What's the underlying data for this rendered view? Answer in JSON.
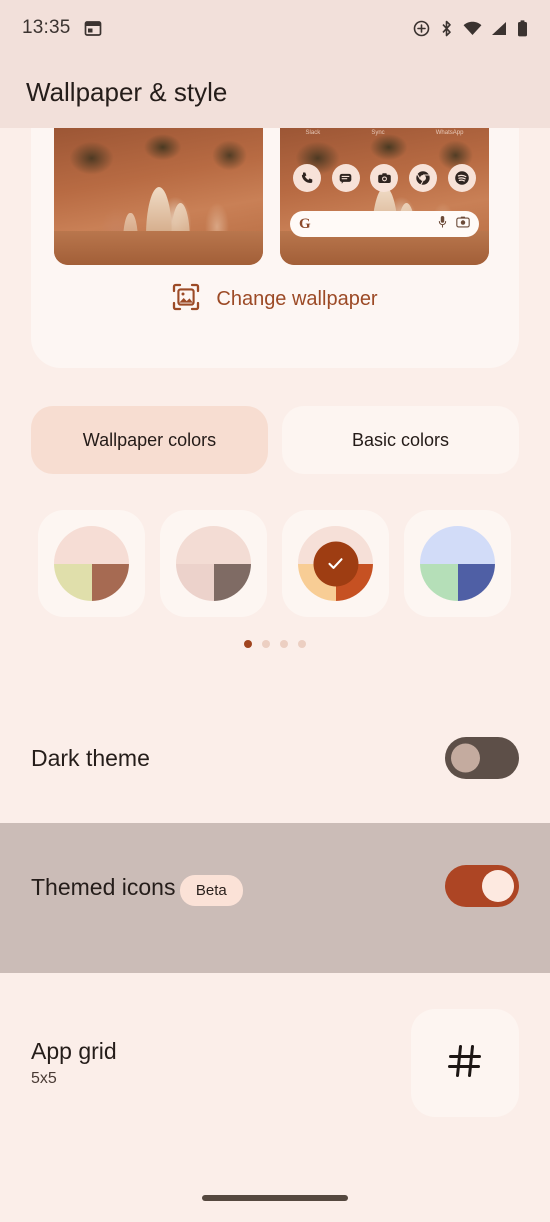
{
  "status_bar": {
    "time": "13:35",
    "left_icons": [
      {
        "name": "calendar-icon"
      }
    ],
    "right_icons": [
      {
        "name": "data-saver-icon"
      },
      {
        "name": "bluetooth-icon"
      },
      {
        "name": "wifi-icon"
      },
      {
        "name": "cellular-signal-icon"
      },
      {
        "name": "battery-icon"
      }
    ]
  },
  "app_bar": {
    "title": "Wallpaper & style"
  },
  "preview": {
    "lock_screen_label": "lock screen preview",
    "home_screen_label": "home screen preview",
    "home_app_labels": [
      "Slack",
      "Sync",
      "WhatsApp"
    ],
    "dock_icons": [
      {
        "name": "phone-icon",
        "glyph": "✆"
      },
      {
        "name": "messages-icon",
        "glyph": "☰"
      },
      {
        "name": "camera-icon",
        "glyph": "◉"
      },
      {
        "name": "chrome-icon",
        "glyph": "◎"
      },
      {
        "name": "spotify-icon",
        "glyph": "♬"
      }
    ],
    "search": {
      "g_logo": "G",
      "mic_icon": "mic-icon",
      "lens_icon": "lens-icon"
    }
  },
  "change_wallpaper": {
    "label": "Change wallpaper",
    "icon": "image-frame-icon",
    "color": "#9c4a26"
  },
  "color_tabs": [
    {
      "label": "Wallpaper colors",
      "selected": true
    },
    {
      "label": "Basic colors",
      "selected": false
    }
  ],
  "swatches": [
    {
      "name": "swatch-1",
      "selected": false,
      "top": "#f6ddd5",
      "bottom_left": "#e0dfab",
      "bottom_right": "#a66a52"
    },
    {
      "name": "swatch-2",
      "selected": false,
      "top": "#f3dcd4",
      "bottom_left": "#ecd2cb",
      "bottom_right": "#7f6b64"
    },
    {
      "name": "swatch-3",
      "selected": true,
      "top": "#f6e0d8",
      "bottom_left": "#f8cd95",
      "bottom_right": "#c65122",
      "check_bg": "#9e3d12",
      "check_color": "#ffffff"
    },
    {
      "name": "swatch-4",
      "selected": false,
      "top": "#d2dcf8",
      "bottom_left": "#b5dfb8",
      "bottom_right": "#4f5fa5"
    }
  ],
  "page_dots": {
    "count": 4,
    "active_index": 0,
    "active_color": "#a0441f",
    "inactive_color": "#eccfc2"
  },
  "settings": {
    "dark_theme": {
      "title": "Dark theme",
      "enabled": false
    },
    "themed_icons": {
      "title": "Themed icons",
      "badge": "Beta",
      "enabled": true,
      "highlighted": true
    },
    "app_grid": {
      "title": "App grid",
      "value": "5x5",
      "icon": "grid-icon"
    }
  },
  "nav_bar": {
    "handle": "home-gesture-handle"
  },
  "colors": {
    "page_background": "#fbeee9",
    "app_bar_background": "#f2e0da",
    "card_background": "#fdf6f3",
    "accent": "#ad4524",
    "highlight_band": "#cbbcb7"
  }
}
